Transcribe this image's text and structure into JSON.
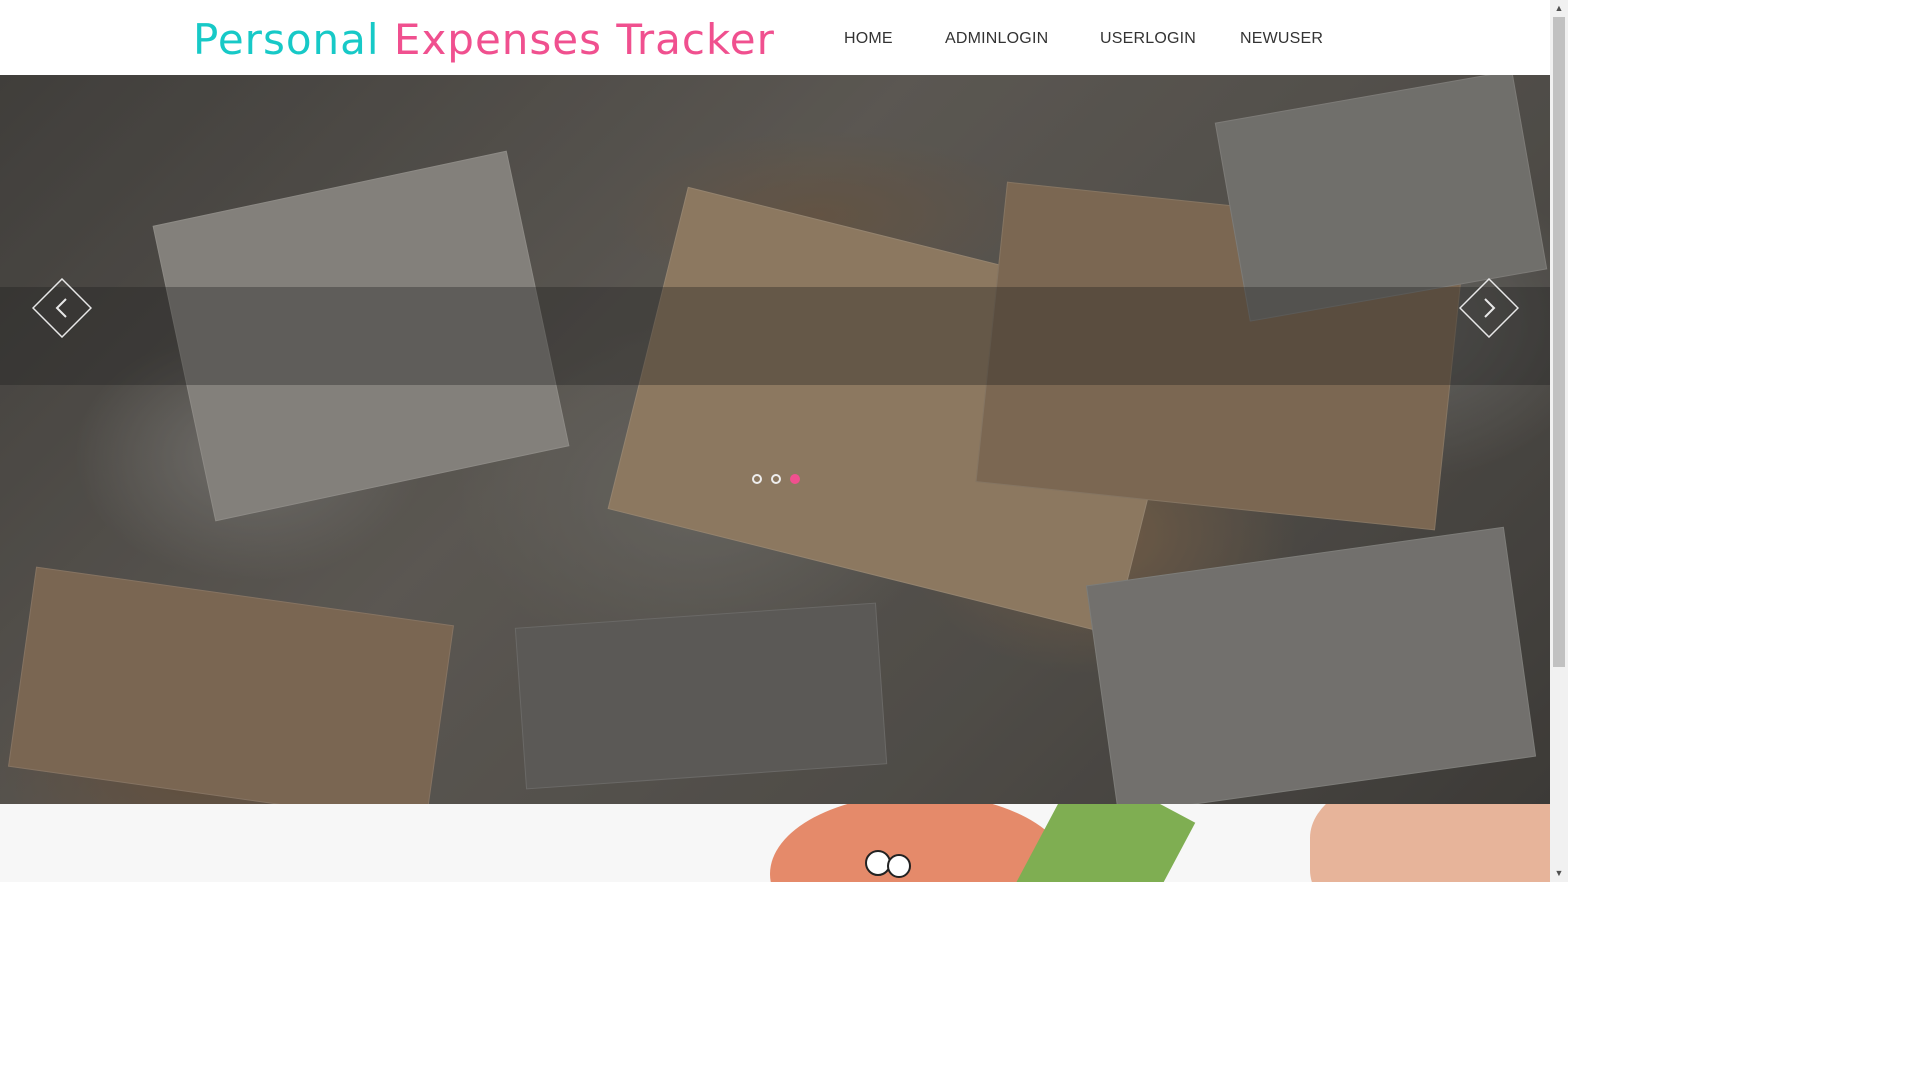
{
  "brand": {
    "word1": "Personal",
    "word2": "Expenses Tracker",
    "color1": "#17c9c7",
    "color2": "#f0508f"
  },
  "nav": {
    "home": "HOME",
    "adminlogin": "ADMINLOGIN",
    "userlogin": "USERLOGIN",
    "newuser": "NEWUSER"
  },
  "carousel": {
    "slide_count": 3,
    "active_index": 3,
    "prev_icon": "chevron-left-icon",
    "next_icon": "chevron-right-icon",
    "accent": "#f0508f"
  }
}
